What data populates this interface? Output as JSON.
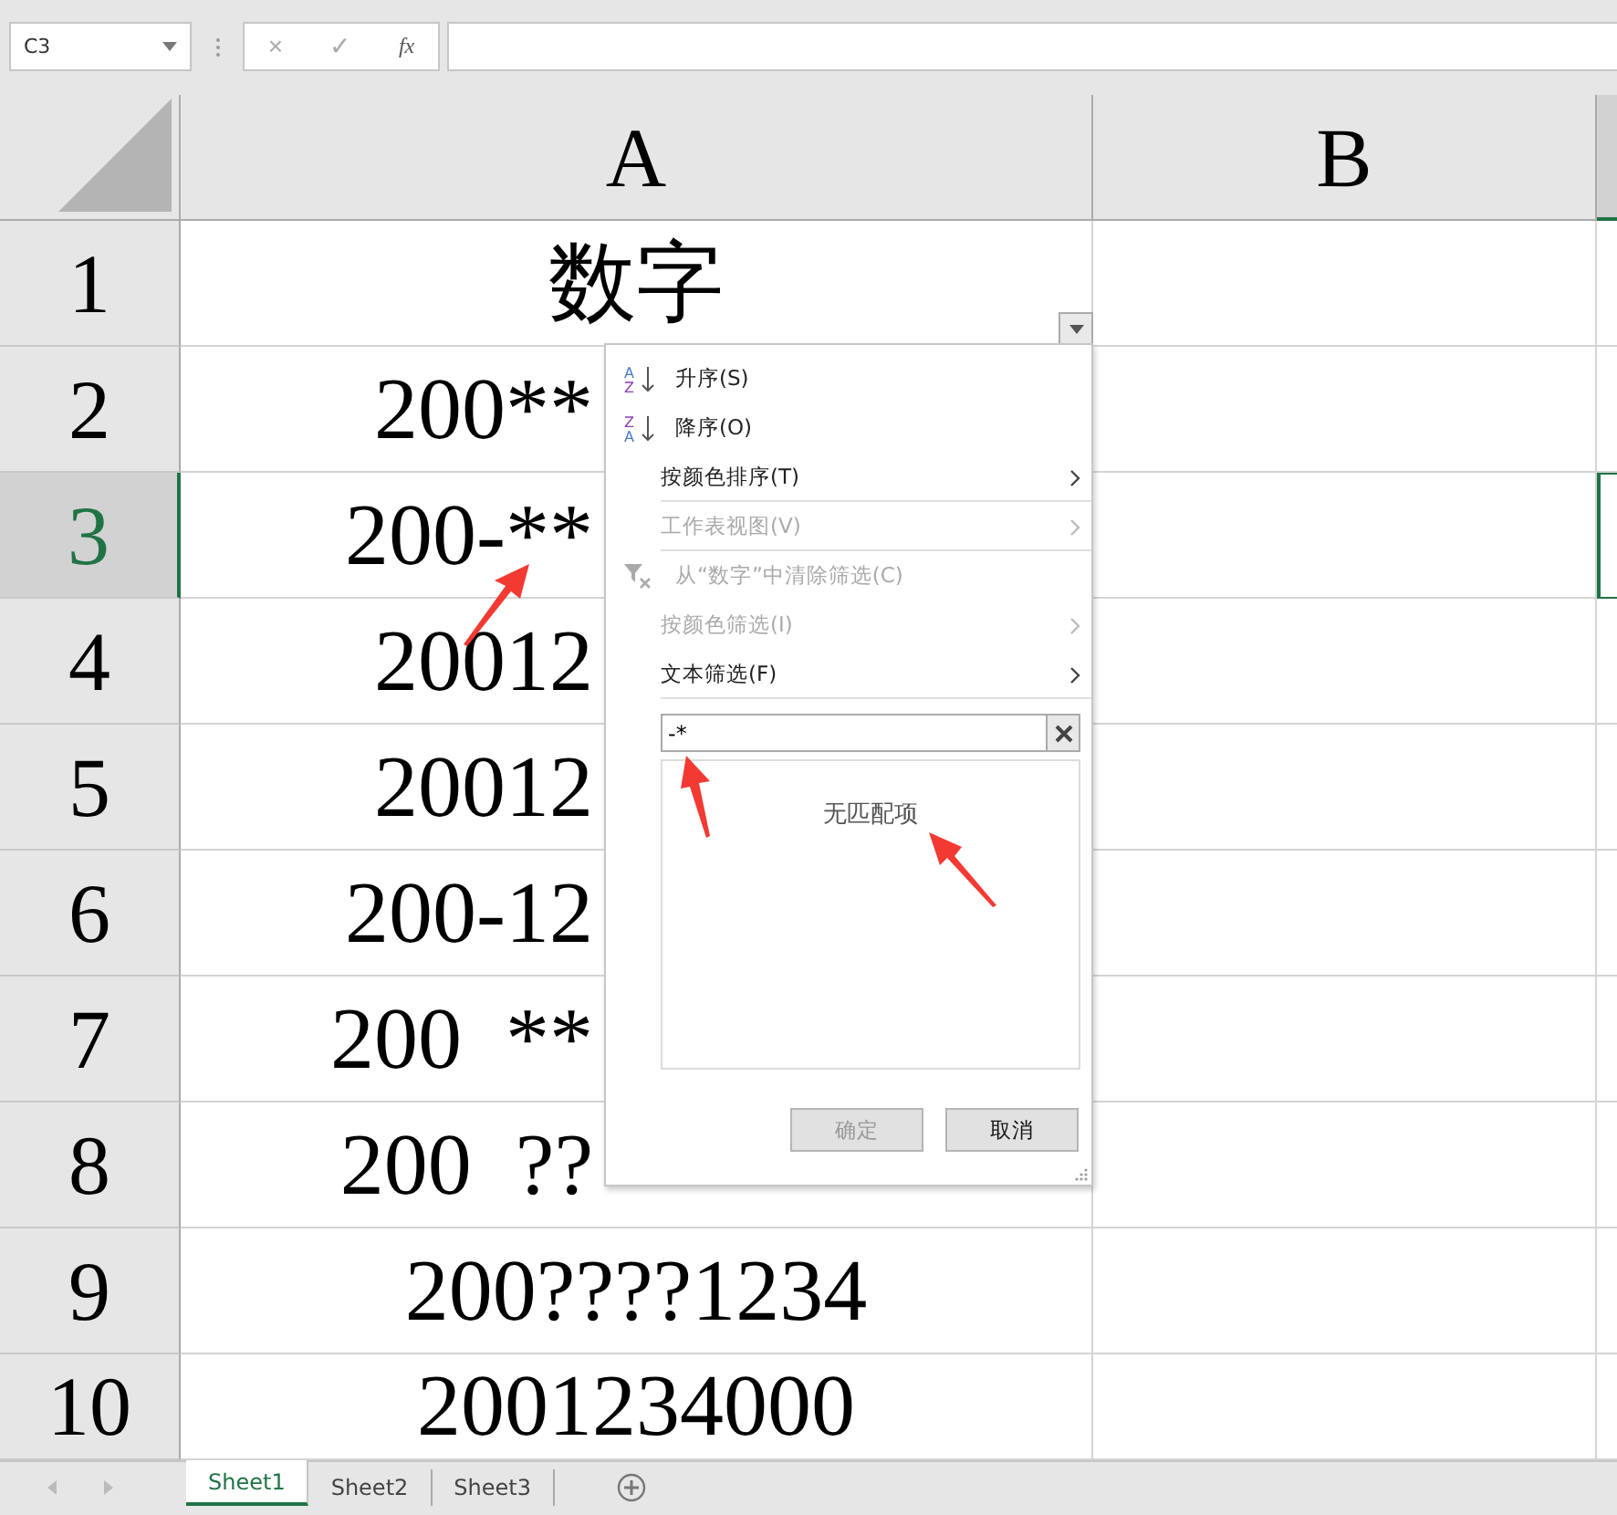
{
  "name_box": {
    "value": "C3"
  },
  "formula_bar": {
    "cancel": "×",
    "enter": "✓",
    "function": "fx"
  },
  "columns": [
    {
      "label": "A",
      "selected": false
    },
    {
      "label": "B",
      "selected": false
    }
  ],
  "rows": [
    {
      "number": "1",
      "selected": false,
      "cell": "数字",
      "clipped": false
    },
    {
      "number": "2",
      "selected": false,
      "cell": "200**",
      "clipped": true
    },
    {
      "number": "3",
      "selected": true,
      "cell": "200-**",
      "clipped": true
    },
    {
      "number": "4",
      "selected": false,
      "cell": "20012",
      "clipped": true
    },
    {
      "number": "5",
      "selected": false,
      "cell": "20012",
      "clipped": true
    },
    {
      "number": "6",
      "selected": false,
      "cell": "200-12",
      "clipped": true
    },
    {
      "number": "7",
      "selected": false,
      "cell": "200  **",
      "clipped": true
    },
    {
      "number": "8",
      "selected": false,
      "cell": "200  ??",
      "clipped": true
    },
    {
      "number": "9",
      "selected": false,
      "cell": "200????1234",
      "clipped": false
    },
    {
      "number": "10",
      "selected": false,
      "cell": "2001234000",
      "clipped": false
    }
  ],
  "filter_menu": {
    "items": [
      {
        "kind": "sort-asc",
        "icon_letters": [
          "A",
          "Z"
        ],
        "label": "升序(S)",
        "disabled": false
      },
      {
        "kind": "sort-desc",
        "icon_letters": [
          "Z",
          "A"
        ],
        "label": "降序(O)",
        "disabled": false
      },
      {
        "kind": "submenu",
        "label": "按颜色排序(T)",
        "disabled": false
      },
      {
        "kind": "submenu",
        "label": "工作表视图(V)",
        "disabled": true
      },
      {
        "kind": "clear",
        "label": "从“数字”中清除筛选(C)",
        "disabled": true
      },
      {
        "kind": "submenu",
        "label": "按颜色筛选(I)",
        "disabled": true
      },
      {
        "kind": "submenu",
        "label": "文本筛选(F)",
        "disabled": false
      }
    ],
    "search": {
      "value": "-*"
    },
    "empty_message": "无匹配项",
    "buttons": [
      {
        "label": "确定",
        "disabled": true
      },
      {
        "label": "取消",
        "disabled": false
      }
    ]
  },
  "sheet_tabs": [
    {
      "label": "Sheet1",
      "selected": true
    },
    {
      "label": "Sheet2",
      "selected": false
    },
    {
      "label": "Sheet3",
      "selected": false
    }
  ]
}
